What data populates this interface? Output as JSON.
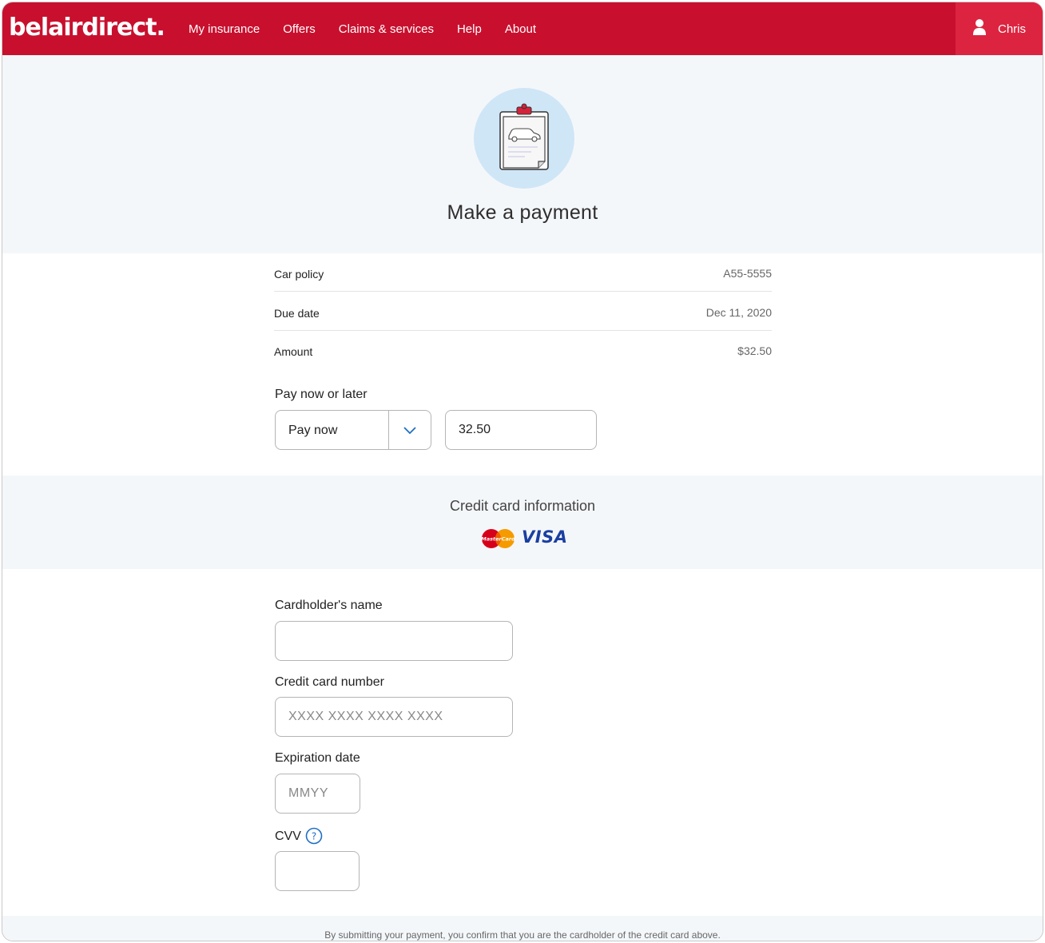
{
  "header": {
    "logo": "belairdirect.",
    "nav": [
      "My insurance",
      "Offers",
      "Claims & services",
      "Help",
      "About"
    ],
    "user_name": "Chris",
    "brand_color": "#c8102e"
  },
  "hero": {
    "title": "Make a payment",
    "icon": "clipboard-car-icon"
  },
  "summary": {
    "rows": [
      {
        "label": "Car policy",
        "value": "A55-5555"
      },
      {
        "label": "Due date",
        "value": "Dec 11, 2020"
      },
      {
        "label": "Amount",
        "value": "$32.50"
      }
    ],
    "pay_label": "Pay now or later",
    "pay_option": "Pay now",
    "pay_amount": "32.50"
  },
  "credit_card": {
    "title": "Credit card information",
    "brands": [
      "MasterCard",
      "VISA"
    ]
  },
  "form": {
    "cardholder_label": "Cardholder's name",
    "cardholder_value": "",
    "card_number_label": "Credit card number",
    "card_number_placeholder": "XXXX XXXX XXXX XXXX",
    "expiration_label": "Expiration date",
    "expiration_placeholder": "MMYY",
    "cvv_label": "CVV",
    "cvv_value": ""
  },
  "footer": {
    "disclaimer": "By submitting your payment, you confirm that you are the cardholder of the credit card above."
  }
}
